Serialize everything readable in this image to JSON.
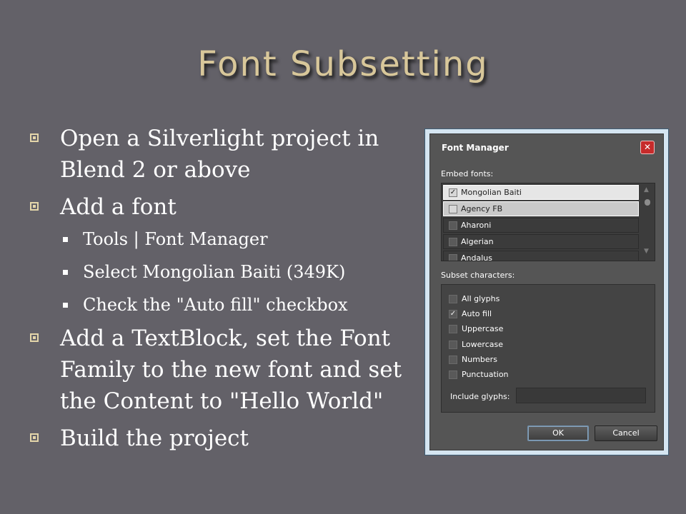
{
  "slide": {
    "title": "Font Subsetting",
    "bullets": [
      {
        "text": "Open a Silverlight project in Blend 2 or above"
      },
      {
        "text": "Add a font",
        "sub": [
          "Tools | Font Manager",
          "Select Mongolian Baiti (349K)",
          "Check the \"Auto fill\" checkbox"
        ]
      },
      {
        "text": "Add a TextBlock, set the Font Family to the new font and set the Content to \"Hello World\""
      },
      {
        "text": "Build the project"
      }
    ]
  },
  "dialog": {
    "title": "Font Manager",
    "close": "✕",
    "embed_label": "Embed fonts:",
    "fonts": [
      {
        "name": "Mongolian Baiti",
        "checked": "✓"
      },
      {
        "name": "Agency FB",
        "checked": ""
      },
      {
        "name": "Aharoni",
        "checked": ""
      },
      {
        "name": "Algerian",
        "checked": ""
      },
      {
        "name": "Andalus",
        "checked": ""
      }
    ],
    "subset_label": "Subset characters:",
    "options": [
      {
        "label": "All glyphs",
        "checked": ""
      },
      {
        "label": "Auto fill",
        "checked": "✓"
      },
      {
        "label": "Uppercase",
        "checked": ""
      },
      {
        "label": "Lowercase",
        "checked": ""
      },
      {
        "label": "Numbers",
        "checked": ""
      },
      {
        "label": "Punctuation",
        "checked": ""
      }
    ],
    "include_glyphs_label": "Include glyphs:",
    "include_glyphs_value": "",
    "ok": "OK",
    "cancel": "Cancel"
  },
  "icons": {
    "bullet_l1": "box-bullet-icon",
    "bullet_l2": "square-bullet-icon",
    "close": "close-icon",
    "scroll_up": "scroll-up-arrow-icon",
    "scroll_down": "scroll-down-arrow-icon"
  },
  "colors": {
    "background": "#636168",
    "title": "#d8c79a",
    "text": "#ffffff",
    "dialog_bg": "#555555",
    "close_button": "#c62b2b"
  }
}
